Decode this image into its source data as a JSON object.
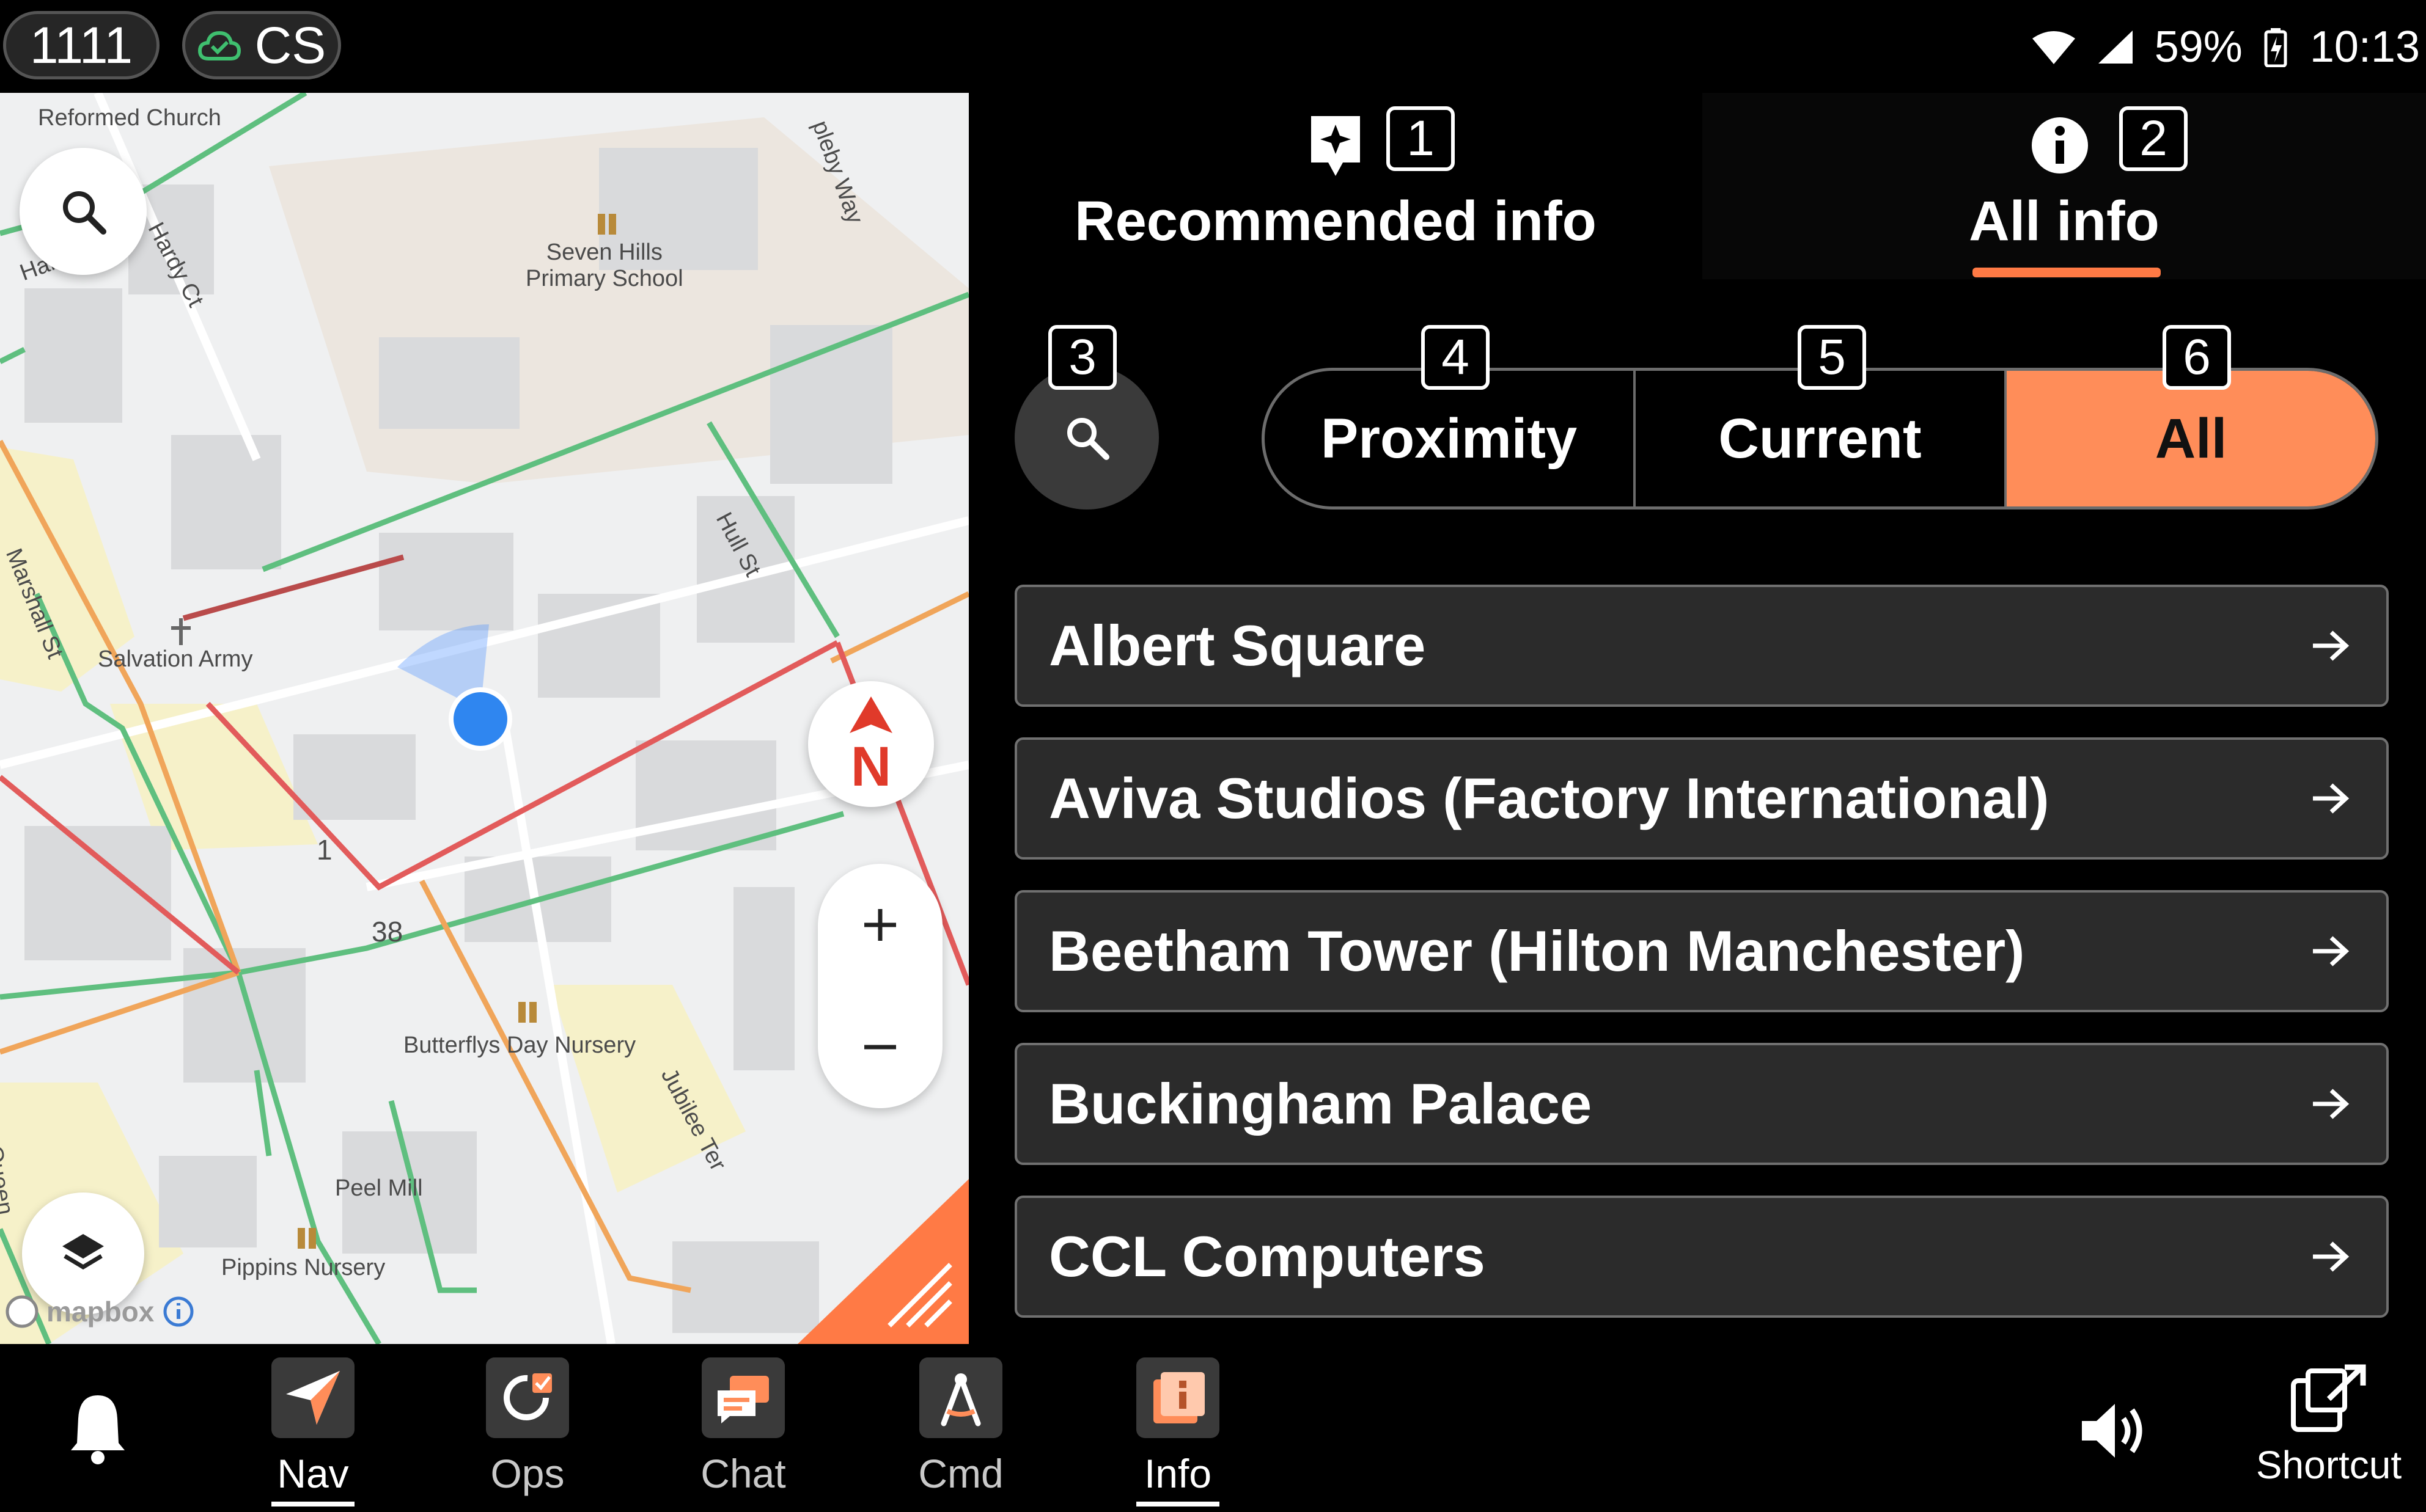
{
  "status_bar": {
    "unit_id": "1111",
    "cloud_label": "CS",
    "battery": "59%",
    "time": "10:13",
    "icons": [
      "wifi-icon",
      "signal-icon",
      "battery-charging-icon"
    ]
  },
  "map": {
    "labels": {
      "church": "Reformed Church",
      "street_hardy": "Hardy St",
      "street_hardy_ct": "Hardy Ct",
      "school": "Seven Hills\nPrimary School",
      "street_appleby": "pleby Way",
      "street_marshall": "Marshall St",
      "street_hull": "Hull St",
      "salvation": "Salvation Army",
      "num_1": "1",
      "num_38": "38",
      "nursery_butterflys": "Butterflys Day Nursery",
      "street_jubilee": "Jubilee Ter",
      "peel_mill": "Peel Mill",
      "pippins": "Pippins Nursery",
      "street_queen": "Queen",
      "attribution": "mapbox",
      "compass_letter": "N"
    },
    "accent": "#ff7a45"
  },
  "tabs": {
    "recommended": {
      "label": "Recommended info",
      "badge": "1",
      "icon": "sparkle-icon"
    },
    "all": {
      "label": "All info",
      "badge": "2",
      "icon": "info-icon"
    }
  },
  "filters": {
    "search_badge": "3",
    "proximity": {
      "label": "Proximity",
      "badge": "4"
    },
    "current": {
      "label": "Current",
      "badge": "5"
    },
    "all": {
      "label": "All",
      "badge": "6"
    },
    "active_color": "#ff8d59"
  },
  "info_items": [
    "Albert Square",
    "Aviva Studios (Factory International)",
    "Beetham Tower (Hilton Manchester)",
    "Buckingham Palace",
    "CCL Computers"
  ],
  "bottom_nav": {
    "nav": "Nav",
    "ops": "Ops",
    "chat": "Chat",
    "cmd": "Cmd",
    "info": "Info",
    "shortcut": "Shortcut"
  }
}
